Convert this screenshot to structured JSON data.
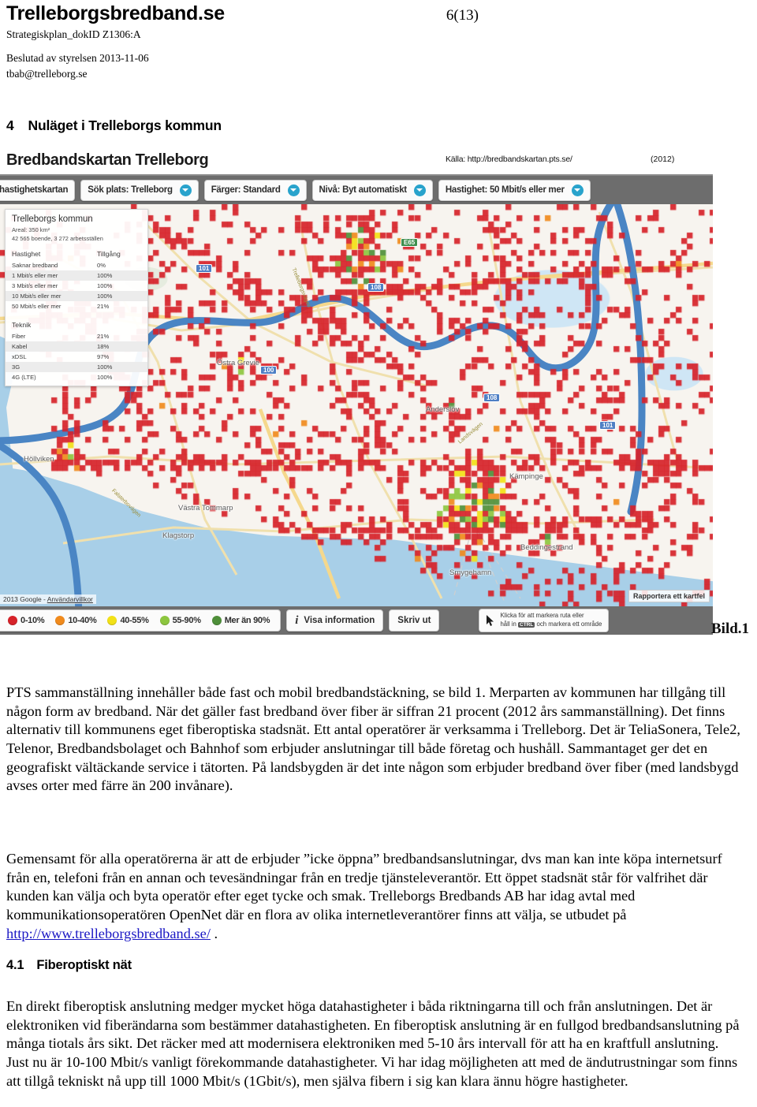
{
  "header": {
    "site_title": "Trelleborgsbredband.se",
    "page_number": "6(13)",
    "dok_id": "Strategiskplan_dokID Z1306:A",
    "decided": "Beslutad av styrelsen 2013-11-06",
    "email": "tbab@trelleborg.se"
  },
  "sections": {
    "s4_number": "4",
    "s4_title": "Nuläget i Trelleborgs kommun",
    "s41_number": "4.1",
    "s41_title": "Fiberoptiskt nät"
  },
  "figure": {
    "map_title": "Bredbandskartan Trelleborg",
    "source": "Källa: http://bredbandskartan.pts.se/",
    "year": "(2012)",
    "caption": "Bild.1",
    "attribution": "2013 Google - ",
    "attribution_link": "Användarvillkor",
    "report_button": "Rapportera ett kartfel",
    "toolbar": [
      {
        "label": "hastighetskartan",
        "caret": false
      },
      {
        "label": "Sök plats: Trelleborg",
        "caret": true
      },
      {
        "label": "Färger: Standard",
        "caret": true
      },
      {
        "label": "Nivå: Byt automatiskt",
        "caret": true
      },
      {
        "label": "Hastighet: 50 Mbit/s eller mer",
        "caret": true
      }
    ],
    "legend": [
      {
        "label": "0-10%",
        "color": "#d62229"
      },
      {
        "label": "10-40%",
        "color": "#f08a1c"
      },
      {
        "label": "40-55%",
        "color": "#f2e117"
      },
      {
        "label": "55-90%",
        "color": "#8dc63f"
      },
      {
        "label": "Mer än 90%",
        "color": "#4f8f3a"
      }
    ],
    "legend_buttons": [
      {
        "label": "Visa information",
        "icon": "info-icon"
      },
      {
        "label": "Skriv ut",
        "icon": null
      }
    ],
    "hint": {
      "line1_pre": "Klicka för att markera ruta eller",
      "line2_pre": "håll in ",
      "kbd": "CTRL",
      "line2_post": " och markera ett område"
    },
    "info_panel": {
      "title": "Trelleborgs kommun",
      "area": "Areal: 350 km²",
      "population": "42 565 boende, 3 272 arbetsställen",
      "speed_header": {
        "name": "Hastighet",
        "value": "Tillgång"
      },
      "speed_rows": [
        {
          "name": "Saknar bredband",
          "value": "0%"
        },
        {
          "name": "1 Mbit/s eller mer",
          "value": "100%"
        },
        {
          "name": "3 Mbit/s eller mer",
          "value": "100%"
        },
        {
          "name": "10 Mbit/s eller mer",
          "value": "100%"
        },
        {
          "name": "50 Mbit/s eller mer",
          "value": "21%"
        }
      ],
      "tech_header": "Teknik",
      "tech_rows": [
        {
          "name": "Fiber",
          "value": "21%"
        },
        {
          "name": "Kabel",
          "value": "18%"
        },
        {
          "name": "xDSL",
          "value": "97%"
        },
        {
          "name": "3G",
          "value": "100%"
        },
        {
          "name": "4G (LTE)",
          "value": "100%"
        }
      ]
    },
    "map_labels": {
      "places": [
        "Höllviken",
        "Östra Grevie",
        "Västra Tommarp",
        "Anderslöv",
        "Klagstorp",
        "Beddingestrand",
        "Smygehamn",
        "Kämpinge"
      ],
      "shields": [
        "E65",
        "101",
        "108",
        "100"
      ],
      "road_names": [
        "Trelleborgsvägen",
        "Falsterbovägen",
        "Landsvägen"
      ]
    }
  },
  "body": {
    "para1": "PTS sammanställning innehåller både fast och mobil bredbandstäckning, se bild 1. Merparten av kommunen har tillgång till någon form av bredband. När det gäller fast bredband över fiber är siffran 21 procent (2012 års sammanställning). Det finns alternativ till kommunens eget fiberoptiska stadsnät. Ett antal operatörer är verksamma i Trelleborg. Det är TeliaSonera, Tele2, Telenor, Bredbandsbolaget och Bahnhof som erbjuder anslutningar till både företag och hushåll. Sammantaget ger det en geografiskt vältäckande service i tätorten. På landsbygden är det inte någon som erbjuder bredband över fiber (med landsbygd avses orter med färre än 200 invånare).",
    "para2_part1": "Gemensamt för alla operatörerna är att de erbjuder ”icke öppna” bredbandsanslutningar, dvs man kan inte köpa internetsurf från en, telefoni från en annan och tevesändningar från en tredje tjänsteleverantör. Ett öppet stadsnät står för valfrihet där kunden kan välja och byta operatör efter eget tycke och smak. Trelleborgs Bredbands AB har idag avtal med kommunikationsoperatören OpenNet där en flora av olika internetleverantörer finns att välja, se utbudet på ",
    "para2_link": "http://www.trelleborgsbredband.se/",
    "para2_part2": " .",
    "para3": "En direkt fiberoptisk anslutning medger mycket höga datahastigheter i båda riktningarna till och från anslutningen. Det är elektroniken vid fiberändarna som bestämmer datahastigheten. En fiberoptisk anslutning är en fullgod bredbandsanslutning på många tiotals års sikt. Det räcker med att modernisera elektroniken med 5-10 års intervall för att ha en kraftfull anslutning. Just nu är 10-100 Mbit/s vanligt förekommande datahastigheter.  Vi har idag möjligheten att med de ändutrustningar som finns att tillgå tekniskt nå upp till 1000 Mbit/s (1Gbit/s), men själva fibern i sig kan klara ännu högre hastigheter."
  }
}
